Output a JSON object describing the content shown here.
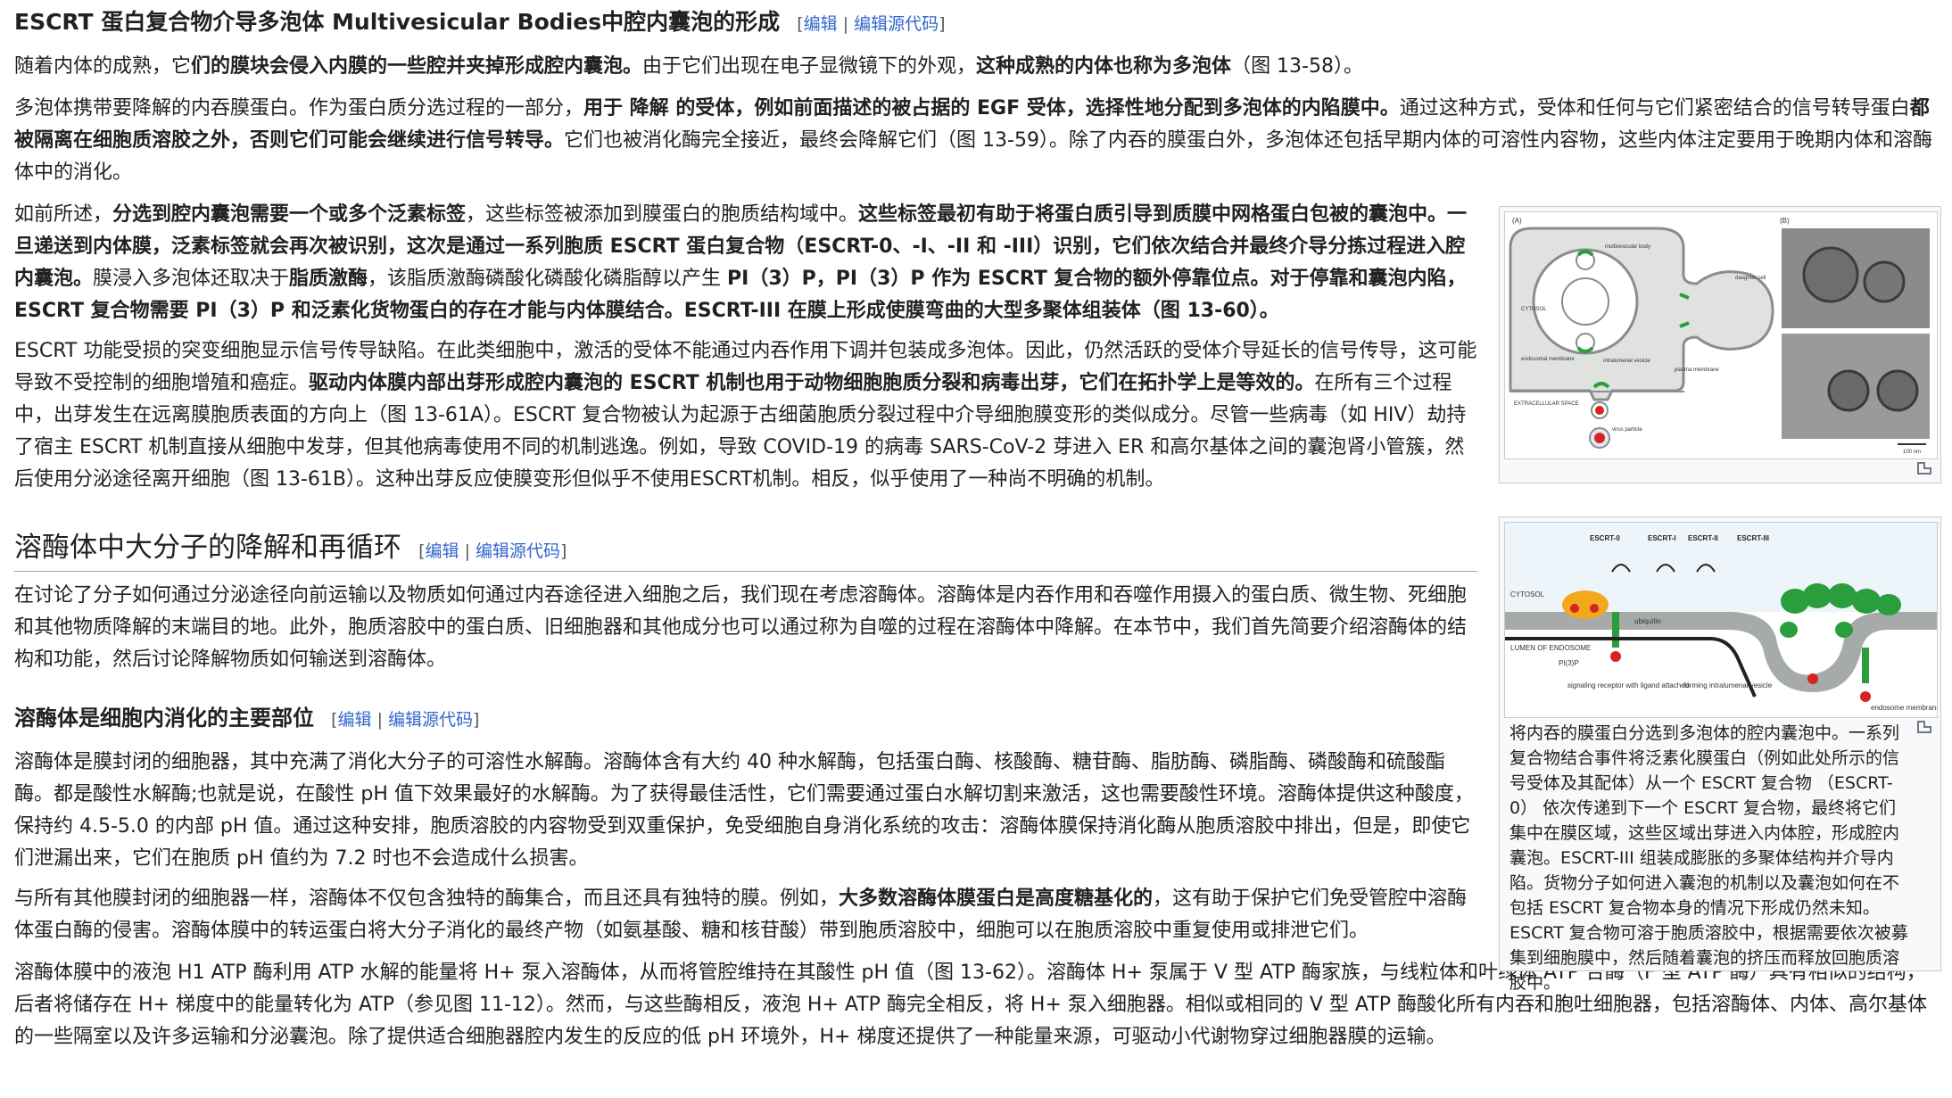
{
  "edit_links": {
    "edit": "编辑",
    "sep": "|",
    "edit_source": "编辑源代码",
    "open": "[",
    "close": "]"
  },
  "section1": {
    "title": "ESCRT 蛋白复合物介导多泡体 Multivesicular Bodies中腔内囊泡的形成",
    "p1": [
      "随着内体的成熟，它",
      "们的膜块会侵入内膜的一些腔并夹掉形成腔内囊泡。",
      "由于它们出现在电子显微镜下的外观，",
      "这种成熟的内体也称为多泡体",
      "（图 13-58）。"
    ],
    "p2": [
      "多泡体携带要降解的内吞膜蛋白。作为蛋白质分选过程的一部分，",
      "用于 降解 的受体，例如前面描述的被占据的 EGF 受体，选择性地分配到多泡体的内陷膜中。",
      "通过这种方式，受体和任何与它们紧密结合的信号转导蛋白",
      "都被隔离在细胞质溶胶之外，否则它们可能会继续进行信号转导。",
      "它们也被消化酶完全接近，最终会降解它们（图 13-59）。除了内吞的膜蛋白外，多泡体还包括早期内体的可溶性内容物，这些内体注定要用于晚期内体和溶酶体中的消化。"
    ],
    "p3": [
      "如前所述，",
      "分选到腔内囊泡需要一个或多个泛素标签",
      "，这些标签被添加到膜蛋白的胞质结构域中。",
      "这些标签最初有助于将蛋白质引导到质膜中网格蛋白包被的囊泡中。一旦递送到内体膜，泛素标签就会再次被识别，这次是通过一系列胞质 ESCRT 蛋白复合物（ESCRT-0、-I、-II 和 -III）识别，它们依次结合并最终介导分拣过程进入腔内囊泡。",
      "膜浸入多泡体还取决于",
      "脂质激酶",
      "，该脂质激酶磷酸化磷酸化磷脂醇以产生 ",
      "PI（3）P，PI（3）P 作为 ESCRT 复合物的额外停靠位点。对于停靠和囊泡内陷，ESCRT 复合物需要 PI（3）P 和泛素化货物蛋白的存在才能与内体膜结合。ESCRT-III 在膜上形成使膜弯曲的大型多聚体组装体（图 13-60）。"
    ],
    "p4": [
      "ESCRT 功能受损的突变细胞显示信号传导缺陷。在此类细胞中，激活的受体不能通过内吞作用下调并包装成多泡体。因此，仍然活跃的受体介导延长的信号传导，这可能导致不受控制的细胞增殖和癌症。",
      "驱动内体膜内部出芽形成腔内囊泡的 ESCRT 机制也用于动物细胞胞质分裂和病毒出芽，它们在拓扑学上是等效的。",
      "在所有三个过程中，出芽发生在远离膜胞质表面的方向上（图 13-61A）。ESCRT 复合物被认为起源于古细菌胞质分裂过程中介导细胞膜变形的类似成分。尽管一些病毒（如 HIV）劫持了宿主 ESCRT 机制直接从细胞中发芽，但其他病毒使用不同的机制逃逸。例如，导致 COVID-19 的病毒 SARS-CoV-2 芽进入 ER 和高尔基体之间的囊泡肾小管簇，然后使用分泌途径离开细胞（图 13-61B）。这种出芽反应使膜变形但似乎不使用ESCRT机制。相反，似乎使用了一种尚不明确的机制。"
    ]
  },
  "section2": {
    "title": "溶酶体中大分子的降解和再循环",
    "p1": "在讨论了分子如何通过分泌途径向前运输以及物质如何通过内吞途径进入细胞之后，我们现在考虑溶酶体。溶酶体是内吞作用和吞噬作用摄入的蛋白质、微生物、死细胞和其他物质降解的末端目的地。此外，胞质溶胶中的蛋白质、旧细胞器和其他成分也可以通过称为自噬的过程在溶酶体中降解。在本节中，我们首先简要介绍溶酶体的结构和功能，然后讨论降解物质如何输送到溶酶体。"
  },
  "section3": {
    "title": "溶酶体是细胞内消化的主要部位",
    "p1": "溶酶体是膜封闭的细胞器，其中充满了消化大分子的可溶性水解酶。溶酶体含有大约 40 种水解酶，包括蛋白酶、核酸酶、糖苷酶、脂肪酶、磷脂酶、磷酸酶和硫酸酯酶。都是酸性水解酶;也就是说，在酸性 pH 值下效果最好的水解酶。为了获得最佳活性，它们需要通过蛋白水解切割来激活，这也需要酸性环境。溶酶体提供这种酸度，保持约 4.5-5.0 的内部 pH 值。通过这种安排，胞质溶胶的内容物受到双重保护，免受细胞自身消化系统的攻击：溶酶体膜保持消化酶从胞质溶胶中排出，但是，即使它们泄漏出来，它们在胞质 pH 值约为 7.2 时也不会造成什么损害。",
    "p2": [
      "与所有其他膜封闭的细胞器一样，溶酶体不仅包含独特的酶集合，而且还具有独特的膜。例如，",
      "大多数溶酶体膜蛋白是高度糖基化的",
      "，这有助于保护它们免受管腔中溶酶体蛋白酶的侵害。溶酶体膜中的转运蛋白将大分子消化的最终产物（如氨基酸、糖和核苷酸）带到胞质溶胶中，细胞可以在胞质溶胶中重复使用或排泄它们。"
    ],
    "p3": "溶酶体膜中的液泡 H1 ATP 酶利用 ATP 水解的能量将 H+ 泵入溶酶体，从而将管腔维持在其酸性 pH 值（图 13-62）。溶酶体 H+ 泵属于 V 型 ATP 酶家族，与线粒体和叶绿体 ATP 合酶（F 型 ATP 酶）具有相似的结构，后者将储存在 H+ 梯度中的能量转化为 ATP（参见图 11-12）。然而，与这些酶相反，液泡 H+ ATP 酶完全相反，将 H+ 泵入细胞器。相似或相同的 V 型 ATP 酶酸化所有内吞和胞吐细胞器，包括溶酶体、内体、高尔基体的一些隔室以及许多运输和分泌囊泡。除了提供适合细胞器腔内发生的反应的低 pH 环境外，H+ 梯度还提供了一种能量来源，可驱动小代谢物穿过细胞器膜的运输。"
  },
  "figure1": {
    "panel_a": "(A)",
    "panel_b": "(B)",
    "labels": [
      "multivesicular body",
      "daughter cell",
      "CYTOSOL",
      "endosomal membrane",
      "intralumenal vesicle",
      "plasma membrane",
      "EXTRACELLULAR SPACE",
      "virus particle"
    ],
    "scale": "100 nm"
  },
  "figure2": {
    "labels": {
      "escrt0": "ESCRT-0",
      "escrt1": "ESCRT-I",
      "escrt2": "ESCRT-II",
      "escrt3": "ESCRT-III",
      "cytosol": "CYTOSOL",
      "lumen": "LUMEN OF ENDOSOME",
      "ubiquitin": "ubiquitin",
      "pi3p": "PI(3)P",
      "receptor": "signaling receptor with ligand attached",
      "forming": "forming intralumenal vesicle",
      "endosome_membrane": "endosome membrane"
    },
    "caption": "将内吞的膜蛋白分选到多泡体的腔内囊泡中。一系列复合物结合事件将泛素化膜蛋白（例如此处所示的信号受体及其配体）从一个 ESCRT 复合物 （ESCRT-0） 依次传递到下一个 ESCRT 复合物，最终将它们集中在膜区域，这些区域出芽进入内体腔，形成腔内囊泡。ESCRT-III 组装成膨胀的多聚体结构并介导内陷。货物分子如何进入囊泡的机制以及囊泡如何在不包括 ESCRT 复合物本身的情况下形成仍然未知。ESCRT 复合物可溶于胞质溶胶中，根据需要依次被募集到细胞膜中，然后随着囊泡的挤压而释放回胞质溶胶中。"
  },
  "colors": {
    "link": "#3366cc",
    "membrane_green": "#2a9d3c",
    "membrane_gray": "#a6aaa8",
    "ubiquitin_red": "#d42424",
    "escrt0_orange": "#f4a81d"
  }
}
